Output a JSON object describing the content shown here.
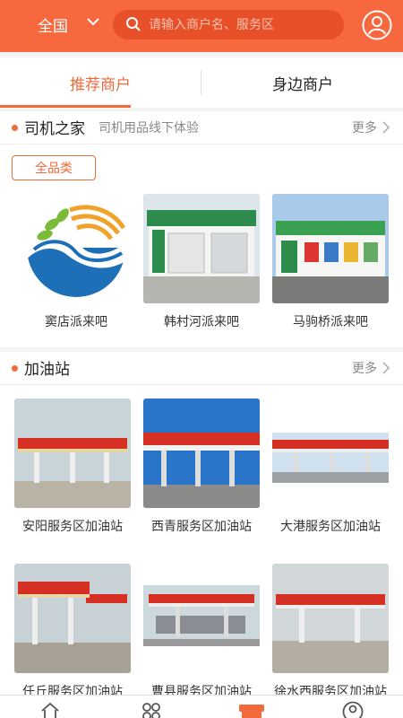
{
  "header": {
    "region": "全国",
    "search_placeholder": "请输入商户名、服务区",
    "colors": {
      "brand": "#f7683f",
      "search_bg": "#e8502a"
    }
  },
  "tabs": [
    {
      "label": "推荐商户",
      "active": true
    },
    {
      "label": "身边商户",
      "active": false
    }
  ],
  "drivers_home": {
    "title": "司机之家",
    "subtitle": "司机用品线下体验",
    "more": "更多",
    "filter": "全品类",
    "items": [
      {
        "label": "窦店派来吧",
        "image": "logo-waves"
      },
      {
        "label": "韩村河派来吧",
        "image": "storefront-green"
      },
      {
        "label": "马驹桥派来吧",
        "image": "storefront-white"
      }
    ]
  },
  "gas_stations": {
    "title": "加油站",
    "more": "更多",
    "items": [
      {
        "label": "安阳服务区加油站"
      },
      {
        "label": "西青服务区加油站"
      },
      {
        "label": "大港服务区加油站"
      },
      {
        "label": "任丘服务区加油站"
      },
      {
        "label": "曹县服务区加油站"
      },
      {
        "label": "徐水西服务区加油站"
      }
    ]
  },
  "bottom_nav": [
    {
      "icon": "home-icon"
    },
    {
      "icon": "apps-icon"
    },
    {
      "icon": "store-icon",
      "active": true
    },
    {
      "icon": "profile-icon"
    }
  ]
}
